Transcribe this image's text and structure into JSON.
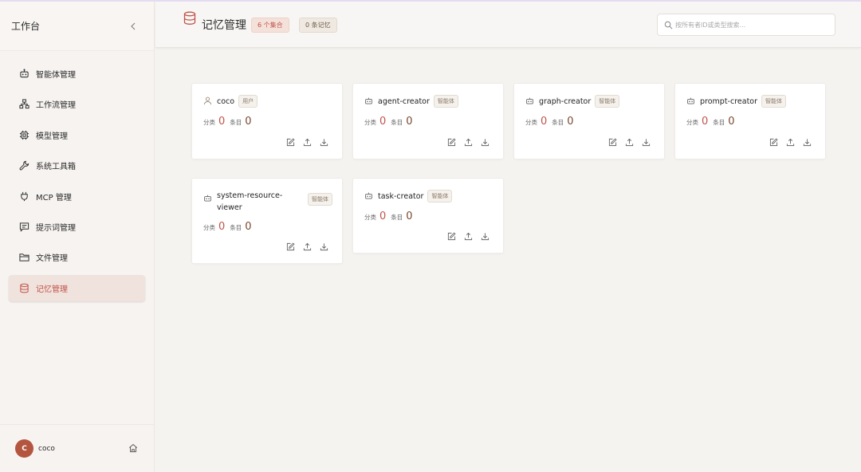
{
  "sidebar": {
    "title": "工作台",
    "collapse_icon": "chevron-left-icon",
    "items": [
      {
        "label": "智能体管理",
        "icon": "robot-icon",
        "active": false
      },
      {
        "label": "工作流管理",
        "icon": "workflow-icon",
        "active": false
      },
      {
        "label": "模型管理",
        "icon": "chip-icon",
        "active": false
      },
      {
        "label": "系统工具箱",
        "icon": "wrench-icon",
        "active": false
      },
      {
        "label": "MCP 管理",
        "icon": "plug-icon",
        "active": false
      },
      {
        "label": "提示词管理",
        "icon": "message-icon",
        "active": false
      },
      {
        "label": "文件管理",
        "icon": "folder-icon",
        "active": false
      },
      {
        "label": "记忆管理",
        "icon": "database-icon",
        "active": true
      }
    ],
    "user": {
      "initial": "C",
      "name": "coco"
    }
  },
  "header": {
    "icon": "database-icon",
    "title": "记忆管理",
    "collections_badge": "6 个集合",
    "memories_badge": "0 条记忆",
    "search_placeholder": "按所有者ID或类型搜索..."
  },
  "cards": [
    {
      "name": "coco",
      "tag": "用户",
      "icon": "user-icon",
      "category_label": "分类",
      "category_count": "0",
      "entry_label": "条目",
      "entry_count": "0"
    },
    {
      "name": "agent-creator",
      "tag": "智能体",
      "icon": "robot-icon",
      "category_label": "分类",
      "category_count": "0",
      "entry_label": "条目",
      "entry_count": "0"
    },
    {
      "name": "graph-creator",
      "tag": "智能体",
      "icon": "robot-icon",
      "category_label": "分类",
      "category_count": "0",
      "entry_label": "条目",
      "entry_count": "0"
    },
    {
      "name": "prompt-creator",
      "tag": "智能体",
      "icon": "robot-icon",
      "category_label": "分类",
      "category_count": "0",
      "entry_label": "条目",
      "entry_count": "0"
    },
    {
      "name_line1": "system-resource-",
      "name_line2": "viewer",
      "tag": "智能体",
      "icon": "robot-icon",
      "category_label": "分类",
      "category_count": "0",
      "entry_label": "条目",
      "entry_count": "0"
    },
    {
      "name": "task-creator",
      "tag": "智能体",
      "icon": "robot-icon",
      "category_label": "分类",
      "category_count": "0",
      "entry_label": "条目",
      "entry_count": "0"
    }
  ],
  "card_action_icons": [
    "edit-icon",
    "upload-icon",
    "download-icon"
  ],
  "colors": {
    "accent": "#c0544a",
    "avatar": "#b4553f",
    "active_bg": "#f0e2dc"
  }
}
